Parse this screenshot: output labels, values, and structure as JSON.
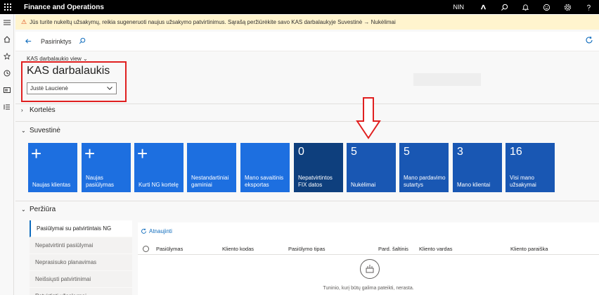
{
  "app": {
    "title": "Finance and Operations",
    "company": "NIN"
  },
  "topbar_icons": [
    "copilot-icon",
    "search-icon",
    "bell-icon",
    "smiley-icon",
    "gear-icon",
    "help-icon"
  ],
  "warning": {
    "text": "Jūs turite nukeltų užsakymų, reikia sugeneruoti naujus užsakymo patvirtinimus. Sąrašą peržiūrėkite savo KAS darbalaukyje Suvestinė → Nukėlimai"
  },
  "actionbar": {
    "label": "Pasirinktys"
  },
  "workspace": {
    "view_label": "KAS darbalaukio view ⌄",
    "title": "KAS darbalaukis",
    "user_value": "Justė Laucienė"
  },
  "sections": {
    "cards": "Kortelės",
    "summary": "Suvestinė",
    "review": "Peržiūra"
  },
  "tiles": [
    {
      "label": "Naujas klientas",
      "plus": "+"
    },
    {
      "label": "Naujas pasiūlymas",
      "plus": "+"
    },
    {
      "label": "Kurti NG kortelę",
      "plus": "+"
    },
    {
      "label": "Nestandartiniai gaminiai"
    },
    {
      "label": "Mano savaitinis eksportas"
    },
    {
      "label": "Nepatvirtintos FIX datos",
      "count": "0"
    },
    {
      "label": "Nukėlimai",
      "count": "5"
    },
    {
      "label": "Mano pardavimo sutartys",
      "count": "5"
    },
    {
      "label": "Mano klientai",
      "count": "3"
    },
    {
      "label": "Visi mano užsakymai",
      "count": "16"
    }
  ],
  "review_tabs": [
    "Pasiūlymai su patvirtintais NG",
    "Nepatvirtinti pasiūlymai",
    "Neprasisuko planavimas",
    "Neišsiųsti patvirtinimai",
    "Patvirtinti užsakymai"
  ],
  "grid": {
    "refresh_label": "Atnaujinti",
    "columns": [
      "Pasiūlymas",
      "Kliento kodas",
      "Pasiūlymo tipas",
      "Pard. šaltinis",
      "Kliento vardas",
      "Kliento paraiška"
    ],
    "empty_text": "Tuninio, kurį būtų galima pateikti, nerasta."
  },
  "colors": {
    "tile": "#1d6fe0",
    "tile_dark": "#0e3f7d",
    "accent": "#0f6cbd",
    "highlight": "#e02020"
  }
}
